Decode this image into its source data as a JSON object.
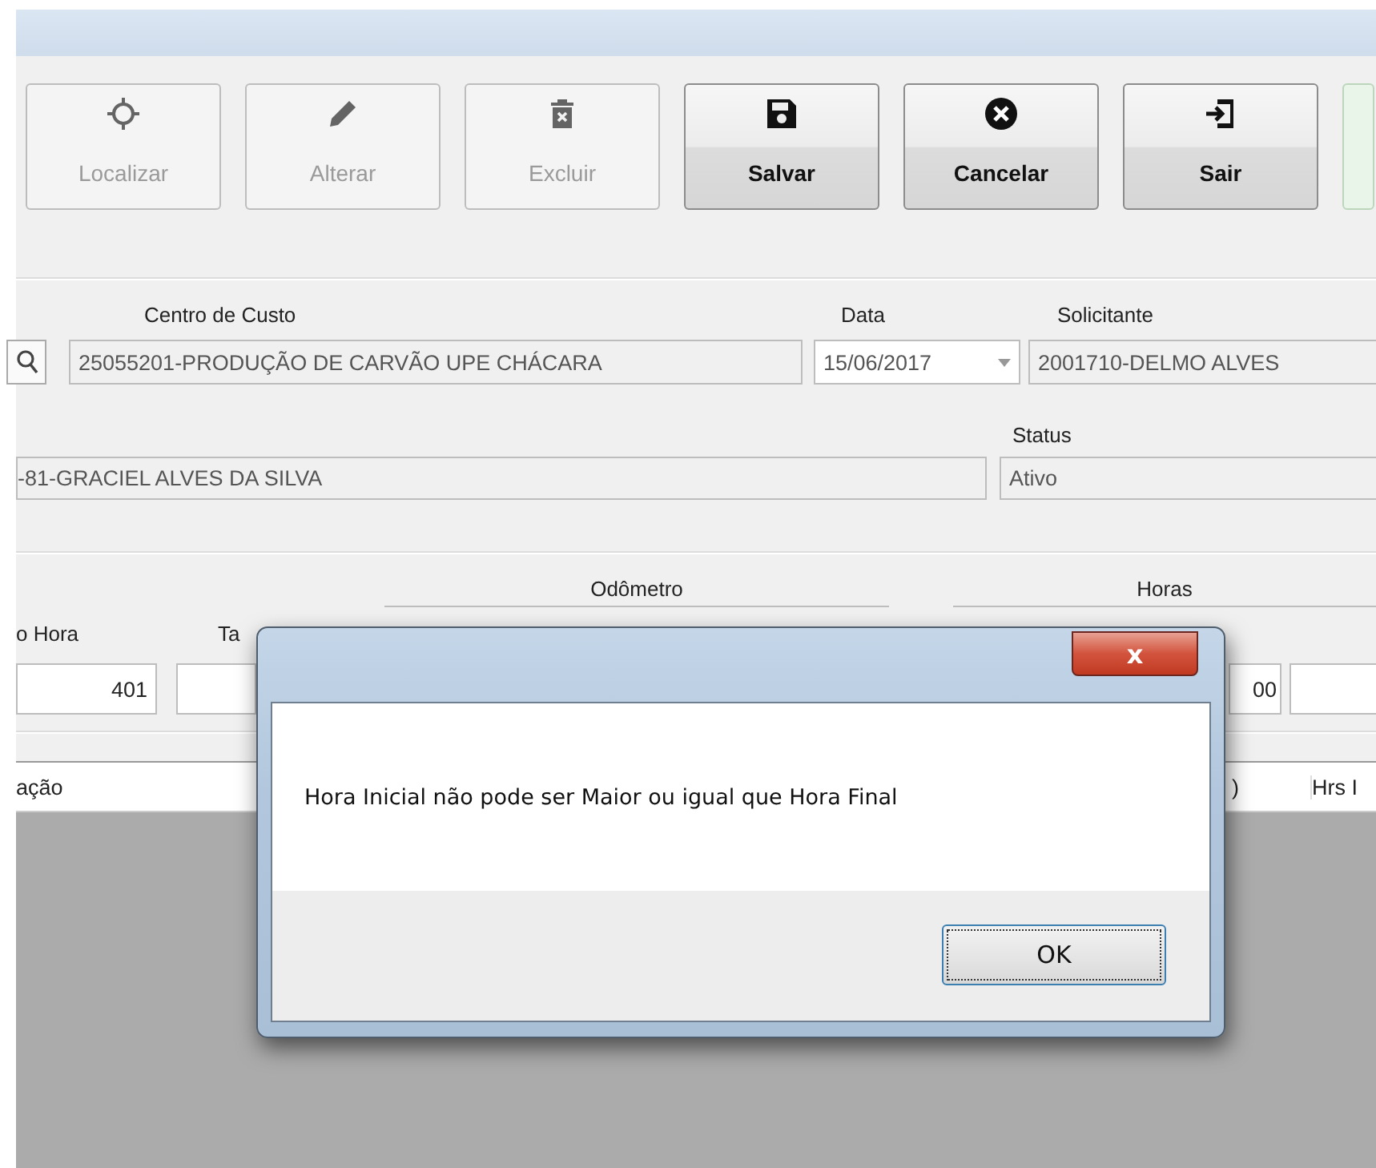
{
  "toolbar": [
    {
      "label": "Localizar",
      "disabled": true
    },
    {
      "label": "Alterar",
      "disabled": true
    },
    {
      "label": "Excluir",
      "disabled": true
    },
    {
      "label": "Salvar",
      "disabled": false
    },
    {
      "label": "Cancelar",
      "disabled": false
    },
    {
      "label": "Sair",
      "disabled": false
    }
  ],
  "form": {
    "cost_center": {
      "label": "Centro de Custo",
      "value": "25055201-PRODUÇÃO DE CARVÃO UPE CHÁCARA"
    },
    "date": {
      "label": "Data",
      "value": "15/06/2017"
    },
    "requester": {
      "label": "Solicitante",
      "value": "2001710-DELMO ALVES"
    },
    "person": {
      "value": "-81-GRACIEL ALVES DA SILVA"
    },
    "status": {
      "label": "Status",
      "value": "Ativo"
    }
  },
  "readings": {
    "groups": [
      "Odômetro",
      "Horas"
    ],
    "labels": [
      "o Hora",
      "Ta"
    ],
    "fields": [
      "401",
      "00"
    ]
  },
  "grid": {
    "columns": [
      "ação",
      ")",
      "Hrs I"
    ]
  },
  "dialog": {
    "message": "Hora Inicial não pode ser Maior ou igual que Hora Final",
    "close": "x",
    "button": "OK"
  }
}
